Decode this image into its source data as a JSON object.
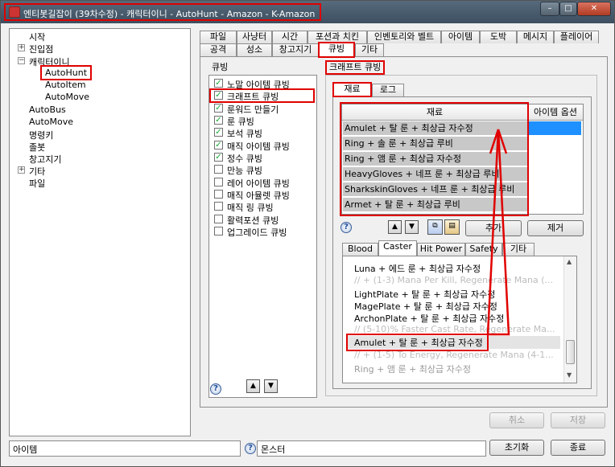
{
  "window": {
    "title": "엔티봇길잡이 (39차수정) - 캐릭터이니 - AutoHunt - Amazon - K-Amazon",
    "min": "–",
    "max": "□",
    "close": "✕"
  },
  "tree": {
    "items": [
      {
        "label": "시작",
        "expander": ""
      },
      {
        "label": "진입점",
        "expander": "+"
      },
      {
        "label": "캐릭터이니",
        "expander": "−"
      },
      {
        "label": "AutoHunt",
        "expander": ""
      },
      {
        "label": "AutoItem",
        "expander": ""
      },
      {
        "label": "AutoMove",
        "expander": ""
      },
      {
        "label": "AutoBus",
        "expander": ""
      },
      {
        "label": "AutoMove",
        "expander": ""
      },
      {
        "label": "명령키",
        "expander": ""
      },
      {
        "label": "졸봇",
        "expander": ""
      },
      {
        "label": "창고지기",
        "expander": ""
      },
      {
        "label": "기타",
        "expander": "+"
      },
      {
        "label": "파일",
        "expander": ""
      }
    ]
  },
  "tabs_row1": [
    "파일",
    "사냥터",
    "시간",
    "포션과 치킨",
    "인벤토리와 벨트",
    "아이템",
    "도박",
    "메시지",
    "플레이어"
  ],
  "tabs_row2": [
    "공격",
    "성소",
    "창고지기",
    "큐빙",
    "기타"
  ],
  "cubing_group": {
    "label": "큐빙",
    "items": [
      {
        "label": "노말 아이템 큐빙",
        "checked": true
      },
      {
        "label": "크래프트 큐빙",
        "checked": true
      },
      {
        "label": "룬워드 만들기",
        "checked": true
      },
      {
        "label": "룬 큐빙",
        "checked": true
      },
      {
        "label": "보석 큐빙",
        "checked": true
      },
      {
        "label": "매직 아이템 큐빙",
        "checked": true
      },
      {
        "label": "정수 큐빙",
        "checked": true
      },
      {
        "label": "만능 큐빙",
        "checked": false
      },
      {
        "label": "레어 아이템 큐빙",
        "checked": false
      },
      {
        "label": "매직 아뮬렛 큐빙",
        "checked": false
      },
      {
        "label": "매직 링 큐빙",
        "checked": false
      },
      {
        "label": "활력포션 큐빙",
        "checked": false
      },
      {
        "label": "업그레이드 큐빙",
        "checked": false
      }
    ],
    "up": "▲",
    "down": "▼",
    "help": "?"
  },
  "craft": {
    "group_label": "크래프트 큐빙",
    "subtabs": [
      "재료",
      "로그"
    ],
    "grid_header": {
      "col1": "재료",
      "col2": "아이템 옵션"
    },
    "grid_rows": [
      "Amulet + 탈 룬 + 최상급 자수정",
      "Ring + 솔 룬 + 최상급 루비",
      "Ring + 앰 룬 + 최상급 자수정",
      "HeavyGloves + 네프 룬 + 최상급 루비",
      "SharkskinGloves + 네프 룬 + 최상급 루비",
      "Armet + 탈 룬 + 최상급 루비"
    ],
    "add_button": "추가",
    "remove_button": "제거",
    "help": "?",
    "up": "▲",
    "down": "▼",
    "category_tabs": [
      "Blood",
      "Caster",
      "Hit Power",
      "Safety",
      "기타"
    ],
    "recipes": [
      {
        "text": "Luna + 에드 룬 + 최상급 자수정",
        "type": "item"
      },
      {
        "text": "// + (1-3) Mana Per Kill, Regenerate Mana (...",
        "type": "comment"
      },
      {
        "text": "LightPlate + 탈 룬 + 최상급 자수정",
        "type": "item"
      },
      {
        "text": "MagePlate + 탈 룬 + 최상급 자수정",
        "type": "item"
      },
      {
        "text": "ArchonPlate + 탈 룬 + 최상급 자수정",
        "type": "item"
      },
      {
        "text": "// (5-10)% Faster Cast Rate, Regenerate Ma...",
        "type": "comment"
      },
      {
        "text": "Amulet + 탈 룬 + 최상급 자수정",
        "type": "selected"
      },
      {
        "text": "// + (1-5) To Energy, Regenerate Mana (4-1...",
        "type": "comment"
      },
      {
        "text": "Ring + 앰 룬 + 최상급 자수정",
        "type": "item"
      }
    ]
  },
  "footer": {
    "cancel": "취소",
    "save": "저장",
    "item_field": "아이템",
    "monster_field": "몬스터",
    "reset": "초기화",
    "exit": "종료",
    "help": "?"
  },
  "colors": {
    "accent": "#e00000",
    "grid_bg": "#c8c8c8",
    "option_cell": "#1e90ff"
  }
}
